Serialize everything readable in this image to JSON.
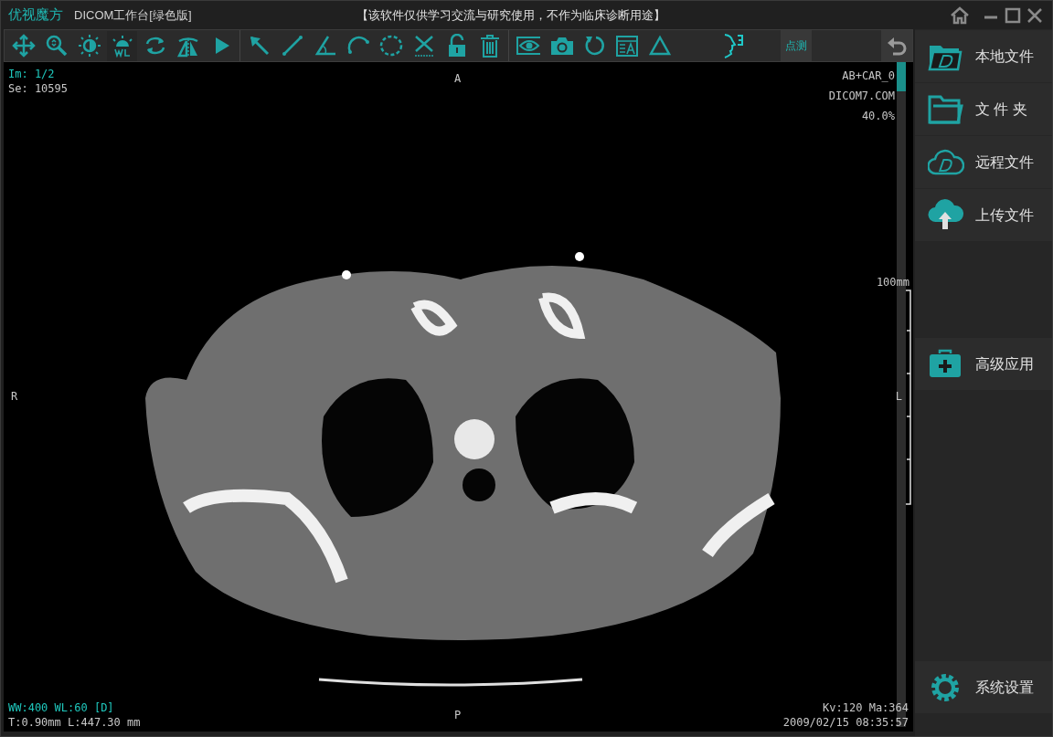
{
  "window": {
    "app_name": "优视魔方",
    "title": "DICOM工作台[绿色版]",
    "notice": "【该软件仅供学习交流与研究使用，不作为临床诊断用途】"
  },
  "toolbar": {
    "mode_button": {
      "label": "点测",
      "selected": true
    }
  },
  "viewer": {
    "overlay_top_left": [
      {
        "text": "Im: 1/2",
        "color": "#1fc8bd"
      },
      {
        "text": "Se: 10595",
        "color": "#c8c8c8"
      }
    ],
    "overlay_top_right": [
      {
        "text": "AB+CAR_0",
        "color": "#c8c8c8"
      },
      {
        "text": "DICOM7.COM",
        "color": "#c8c8c8"
      },
      {
        "text": "40.0%",
        "color": "#c8c8c8"
      }
    ],
    "orientation": {
      "top": "A",
      "left": "R",
      "right": "L",
      "bottom": "P"
    },
    "scale_label": "100mm",
    "overlay_bottom_left": [
      {
        "text": "WW:400 WL:60 [D]",
        "color": "#1fc8bd"
      },
      {
        "text": "T:0.90mm L:447.30 mm",
        "color": "#c8c8c8"
      }
    ],
    "overlay_bottom_right": [
      {
        "text": "Kv:120   Ma:364",
        "color": "#c8c8c8"
      },
      {
        "text": "2009/02/15 08:35:57",
        "color": "#c8c8c8"
      }
    ]
  },
  "sidebar": {
    "file_items": [
      {
        "label": "本地文件"
      },
      {
        "label": "文 件 夹"
      },
      {
        "label": "远程文件"
      },
      {
        "label": "上传文件"
      }
    ],
    "app_items": [
      {
        "label": "高级应用"
      }
    ],
    "settings_item": {
      "label": "系统设置"
    }
  }
}
